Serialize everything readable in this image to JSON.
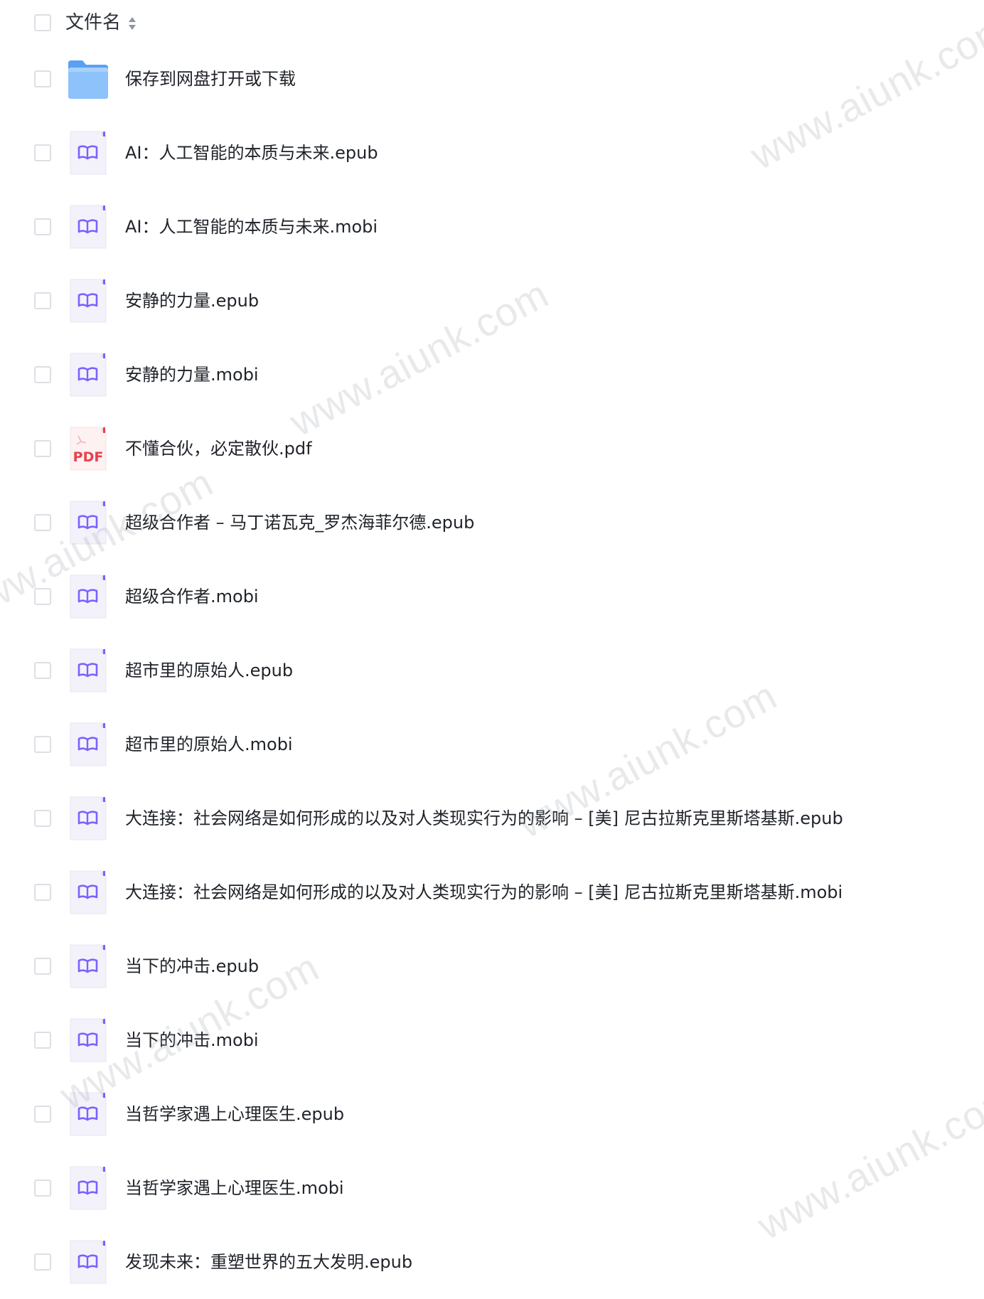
{
  "header": {
    "column_label": "文件名"
  },
  "files": [
    {
      "name": "保存到网盘打开或下载",
      "icon": "folder-icon",
      "type": "folder"
    },
    {
      "name": "AI：人工智能的本质与未来.epub",
      "icon": "ebook-icon",
      "type": "ebook"
    },
    {
      "name": "AI：人工智能的本质与未来.mobi",
      "icon": "ebook-icon",
      "type": "ebook"
    },
    {
      "name": "安静的力量.epub",
      "icon": "ebook-icon",
      "type": "ebook"
    },
    {
      "name": "安静的力量.mobi",
      "icon": "ebook-icon",
      "type": "ebook"
    },
    {
      "name": "不懂合伙，必定散伙.pdf",
      "icon": "pdf-icon",
      "type": "pdf",
      "icon_text": "PDF"
    },
    {
      "name": "超级合作者 – 马丁诺瓦克_罗杰海菲尔德.epub",
      "icon": "ebook-icon",
      "type": "ebook"
    },
    {
      "name": "超级合作者.mobi",
      "icon": "ebook-icon",
      "type": "ebook"
    },
    {
      "name": "超市里的原始人.epub",
      "icon": "ebook-icon",
      "type": "ebook"
    },
    {
      "name": "超市里的原始人.mobi",
      "icon": "ebook-icon",
      "type": "ebook"
    },
    {
      "name": "大连接：社会网络是如何形成的以及对人类现实行为的影响 – [美] 尼古拉斯克里斯塔基斯.epub",
      "icon": "ebook-icon",
      "type": "ebook"
    },
    {
      "name": "大连接：社会网络是如何形成的以及对人类现实行为的影响 – [美] 尼古拉斯克里斯塔基斯.mobi",
      "icon": "ebook-icon",
      "type": "ebook"
    },
    {
      "name": "当下的冲击.epub",
      "icon": "ebook-icon",
      "type": "ebook"
    },
    {
      "name": "当下的冲击.mobi",
      "icon": "ebook-icon",
      "type": "ebook"
    },
    {
      "name": "当哲学家遇上心理医生.epub",
      "icon": "ebook-icon",
      "type": "ebook"
    },
    {
      "name": "当哲学家遇上心理医生.mobi",
      "icon": "ebook-icon",
      "type": "ebook"
    },
    {
      "name": "发现未来：重塑世界的五大发明.epub",
      "icon": "ebook-icon",
      "type": "ebook"
    }
  ],
  "watermarks": [
    "www.aiunk.com",
    "www.aiunk.com",
    "www.aiunk.com",
    "www.aiunk.com",
    "www.aiunk.com",
    "www.aiunk.com"
  ],
  "colors": {
    "folder_blue": "#5aa0f5",
    "ebook_purple": "#7b61ff",
    "pdf_red": "#e8414d",
    "checkbox_border": "#dcdfe4"
  }
}
